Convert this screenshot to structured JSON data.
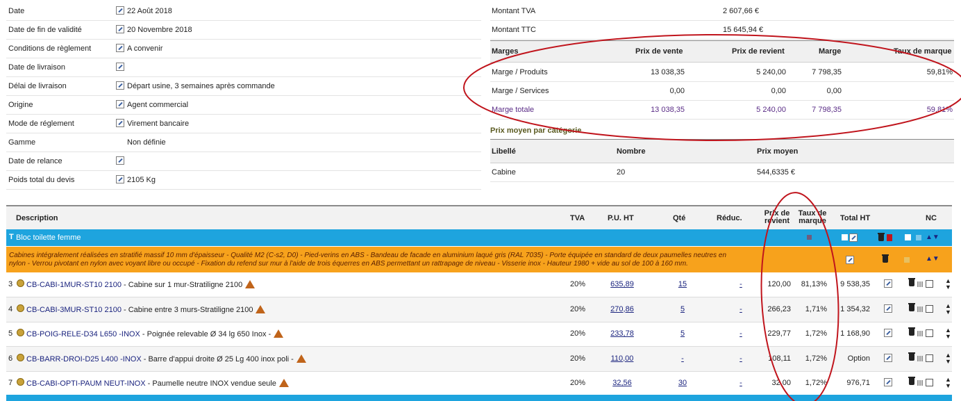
{
  "info_rows": [
    {
      "label": "Date",
      "value": "22 Août 2018",
      "edit": true
    },
    {
      "label": "Date de fin de validité",
      "value": "20 Novembre 2018",
      "edit": true
    },
    {
      "label": "Conditions de règlement",
      "value": "A convenir",
      "edit": true
    },
    {
      "label": "Date de livraison",
      "value": "",
      "edit": true
    },
    {
      "label": "Délai de livraison",
      "value": "Départ usine, 3 semaines après commande",
      "edit": true
    },
    {
      "label": "Origine",
      "value": "Agent commercial",
      "edit": true
    },
    {
      "label": "Mode de réglement",
      "value": "Virement bancaire",
      "edit": true
    },
    {
      "label": "Gamme",
      "value": "Non définie",
      "edit": false
    },
    {
      "label": "Date de relance",
      "value": "",
      "edit": true
    },
    {
      "label": "Poids total du devis",
      "value": "2105 Kg",
      "edit": true
    }
  ],
  "summary": {
    "tva_label": "Montant TVA",
    "tva_value": "2 607,66 €",
    "ttc_label": "Montant TTC",
    "ttc_value": "15 645,94 €"
  },
  "margins": {
    "headers": {
      "label": "Marges",
      "prix_vente": "Prix de vente",
      "prix_revient": "Prix de revient",
      "marge": "Marge",
      "taux": "Taux de marque"
    },
    "rows": [
      {
        "label": "Marge / Produits",
        "prix_vente": "13 038,35",
        "prix_revient": "5 240,00",
        "marge": "7 798,35",
        "taux": "59,81%"
      },
      {
        "label": "Marge / Services",
        "prix_vente": "0,00",
        "prix_revient": "0,00",
        "marge": "0,00",
        "taux": ""
      },
      {
        "label": "Marge totale",
        "prix_vente": "13 038,35",
        "prix_revient": "5 240,00",
        "marge": "7 798,35",
        "taux": "59,81%"
      }
    ]
  },
  "category": {
    "title": "Prix moyen par catégorie",
    "headers": {
      "libelle": "Libellé",
      "nombre": "Nombre",
      "prix": "Prix moyen"
    },
    "row": {
      "libelle": "Cabine",
      "nombre": "20",
      "prix": "544,6335 €"
    }
  },
  "lines_headers": {
    "description": "Description",
    "tva": "TVA",
    "pu": "P.U. HT",
    "qte": "Qté",
    "reduc": "Réduc.",
    "prix_revient_1": "Prix de",
    "prix_revient_2": "revient",
    "taux_1": "Taux de",
    "taux_2": "marque",
    "total": "Total HT",
    "nc": "NC"
  },
  "bloc": {
    "title": "Bloc toilette femme"
  },
  "desc_text_1": "Cabines intégralement réalisées en stratifié massif 10 mm d'épaisseur - Qualité M2 (C-s2, D0) - Pied-verins en ABS - Bandeau de facade en aluminium laqué gris (RAL 7035) - Porte équipée en standard de deux paumelles neutres en",
  "desc_text_2": "nylon - Verrou pivotant en nylon avec voyant libre ou occupé - Fixation du refend sur mur à l'aide de trois équerres en ABS permettant un rattrapage de niveau - Visserie inox - Hauteur 1980 + vide au sol de 100 à 160 mm.",
  "lines": [
    {
      "num": "3",
      "code": "CB-CABI-1MUR-ST10 2100",
      "label": "- Cabine sur 1 mur-Stratiligne 2100",
      "tva": "20%",
      "pu": "635,89",
      "qte": "15",
      "reduc": "-",
      "revient": "120,00",
      "taux": "81,13%",
      "total": "9 538,35"
    },
    {
      "num": "4",
      "code": "CB-CABI-3MUR-ST10 2100",
      "label": "- Cabine entre 3 murs-Stratiligne 2100",
      "tva": "20%",
      "pu": "270,86",
      "qte": "5",
      "reduc": "-",
      "revient": "266,23",
      "taux": "1,71%",
      "total": "1 354,32"
    },
    {
      "num": "5",
      "code": "CB-POIG-RELE-D34 L650 -INOX",
      "label": "- Poignée relevable Ø 34 lg 650 Inox -",
      "tva": "20%",
      "pu": "233,78",
      "qte": "5",
      "reduc": "-",
      "revient": "229,77",
      "taux": "1,72%",
      "total": "1 168,90"
    },
    {
      "num": "6",
      "code": "CB-BARR-DROI-D25 L400 -INOX",
      "label": "- Barre d'appui droite Ø 25 Lg 400 inox poli -",
      "tva": "20%",
      "pu": "110,00",
      "qte": "-",
      "reduc": "-",
      "revient": "108,11",
      "taux": "1,72%",
      "total": "Option"
    },
    {
      "num": "7",
      "code": "CB-CABI-OPTI-PAUM NEUT-INOX",
      "label": "- Paumelle neutre INOX vendue seule",
      "tva": "20%",
      "pu": "32,56",
      "qte": "30",
      "reduc": "-",
      "revient": "32,00",
      "taux": "1,72%",
      "total": "976,71"
    }
  ],
  "colors": {
    "accent": "#1ea4de",
    "description_bg": "#f7a21c",
    "annotation": "#c0141c",
    "link": "#1a237e",
    "purple": "#5a2c86"
  }
}
